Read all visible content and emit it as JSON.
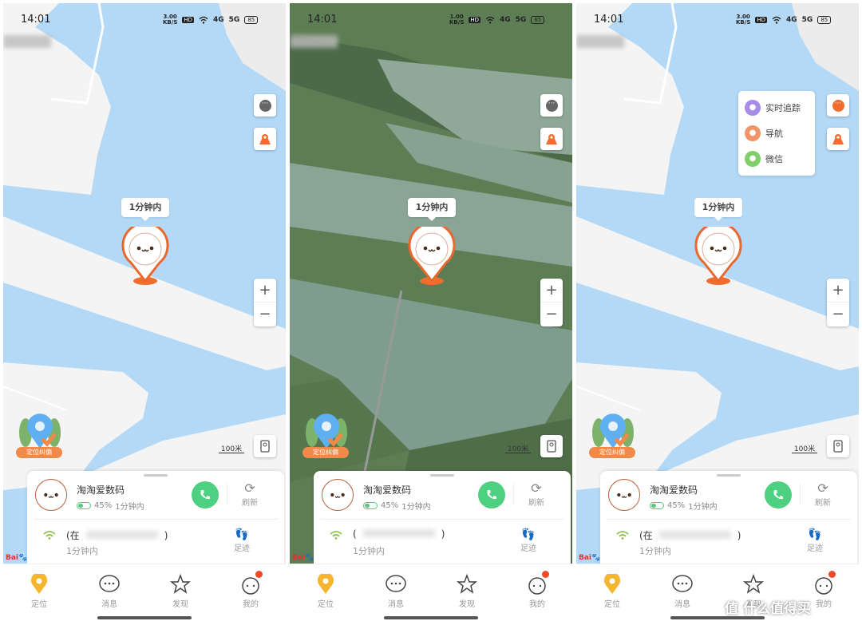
{
  "colors": {
    "accent": "#f06d2e",
    "water": "#b3d9f7",
    "land": "#f4f4f4",
    "call": "#4dd07f",
    "battery": "#5ac87f",
    "nav_active": "#f5b52d",
    "badge": "#f04a2c"
  },
  "panels": [
    {
      "map_style": "standard",
      "status": {
        "time": "14:01",
        "speed": "3.00",
        "speed_unit": "KB/S",
        "hd": "HD",
        "net1": "4G",
        "net2": "5G",
        "battery": "85"
      },
      "menu_open": false
    },
    {
      "map_style": "satellite",
      "status": {
        "time": "14:01",
        "speed": "1.00",
        "speed_unit": "KB/S",
        "hd": "HD",
        "net1": "4G",
        "net2": "5G",
        "battery": "85"
      },
      "menu_open": false
    },
    {
      "map_style": "standard",
      "status": {
        "time": "14:01",
        "speed": "3.00",
        "speed_unit": "KB/S",
        "hd": "HD",
        "net1": "4G",
        "net2": "5G",
        "battery": "85"
      },
      "menu_open": true
    }
  ],
  "map": {
    "bubble": "1分钟内",
    "zoom_in": "+",
    "zoom_out": "−",
    "fix_label": "定位纠偏",
    "scale": "100米",
    "logo": "Bai du 地图"
  },
  "menu": {
    "items": [
      {
        "label": "实时追踪",
        "icon": "share-icon",
        "color": "#a88be8"
      },
      {
        "label": "导航",
        "icon": "navigate-icon",
        "color": "#f0956a"
      },
      {
        "label": "微信",
        "icon": "wechat-icon",
        "color": "#7fcf6a"
      }
    ]
  },
  "card": {
    "name": "淘淘爱数码",
    "battery_pct": "45%",
    "battery_level": 0.45,
    "updated": "1分钟内",
    "refresh": "刷新",
    "address_prefix": [
      "(在",
      "(",
      "(在"
    ],
    "address_suffix": [
      ")",
      ")",
      ")"
    ],
    "address_updated": "1分钟内",
    "track": "足迹"
  },
  "nav": {
    "items": [
      {
        "label": "定位",
        "icon": "location-pin-icon"
      },
      {
        "label": "消息",
        "icon": "chat-icon"
      },
      {
        "label": "发现",
        "icon": "star-icon"
      },
      {
        "label": "我的",
        "icon": "profile-icon"
      }
    ]
  },
  "watermark": "值 什么值得买"
}
